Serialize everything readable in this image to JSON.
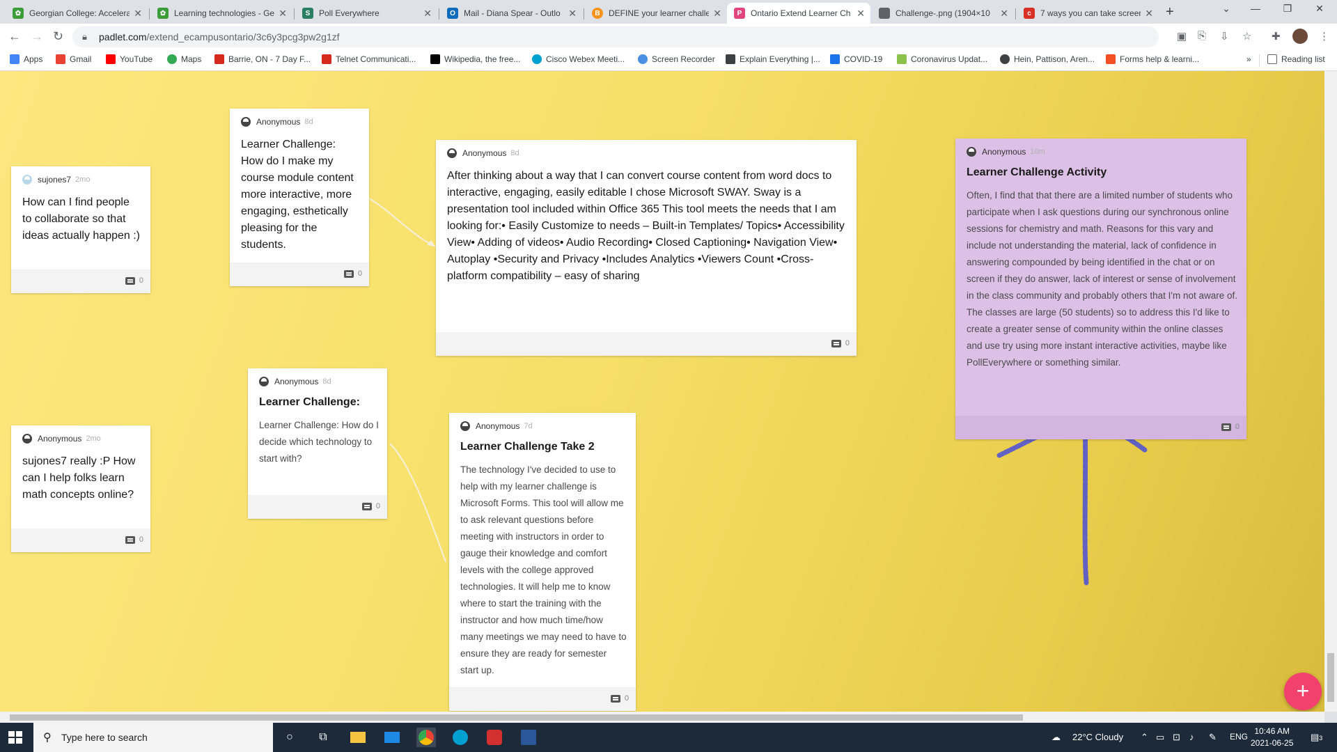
{
  "browser": {
    "tabs": [
      {
        "title": "Georgian College: Accelera",
        "icon_color": "#3a9d3a",
        "active": false
      },
      {
        "title": "Learning technologies - Ge",
        "icon_color": "#3a9d3a",
        "active": false
      },
      {
        "title": "Poll Everywhere",
        "icon_color": "#2a7f62",
        "active": false
      },
      {
        "title": "Mail - Diana Spear - Outlo",
        "icon_color": "#0f6cbd",
        "active": false
      },
      {
        "title": "DEFINE your learner challe",
        "icon_color": "#f7931a",
        "active": false
      },
      {
        "title": "Ontario Extend Learner Ch",
        "icon_color": "#e0457b",
        "active": true
      },
      {
        "title": "Challenge-.png (1904×10",
        "icon_color": "#5f6368",
        "active": false
      },
      {
        "title": "7 ways you can take screen",
        "icon_color": "#d93025",
        "active": false
      }
    ],
    "new_tab_label": "+",
    "url_domain": "padlet.com",
    "url_path": "/extend_ecampusontario/3c6y3pcg3pw2g1zf",
    "bookmarks": [
      {
        "label": "Apps",
        "icon_color": "#4285f4"
      },
      {
        "label": "Gmail",
        "icon_color": "#ea4335"
      },
      {
        "label": "YouTube",
        "icon_color": "#ff0000"
      },
      {
        "label": "Maps",
        "icon_color": "#34a853"
      },
      {
        "label": "Barrie, ON - 7 Day F...",
        "icon_color": "#d52b1e"
      },
      {
        "label": "Telnet Communicati...",
        "icon_color": "#d52b1e"
      },
      {
        "label": "Wikipedia, the free...",
        "icon_color": "#000000"
      },
      {
        "label": "Cisco Webex Meeti...",
        "icon_color": "#00a0d1"
      },
      {
        "label": "Screen Recorder",
        "icon_color": "#4a90e2"
      },
      {
        "label": "Explain Everything |...",
        "icon_color": "#3c4043"
      },
      {
        "label": "COVID-19",
        "icon_color": "#1a73e8"
      },
      {
        "label": "Coronavirus Updat...",
        "icon_color": "#8bc34a"
      },
      {
        "label": "Hein, Pattison, Aren...",
        "icon_color": "#3c4043"
      },
      {
        "label": "Forms help & learni...",
        "icon_color": "#f25022"
      }
    ],
    "bookmarks_overflow": "»",
    "reading_list": "Reading list"
  },
  "padlet": {
    "cards": [
      {
        "author": "sujones7",
        "time": "2mo",
        "big_text": "How can I find people to collaborate so that ideas actually happen :)",
        "comments": "0"
      },
      {
        "author": "Anonymous",
        "time": "8d",
        "big_text": "Learner Challenge: How do I make my course module content more interactive, more engaging, esthetically pleasing for the students.",
        "comments": "0"
      },
      {
        "author": "Anonymous",
        "time": "8d",
        "big_text": "After thinking about a way that I can convert course content from word docs to interactive, engaging, easily editable I chose Microsoft SWAY. Sway is a presentation tool included within Office 365 This tool meets the needs that I am looking for:•  Easily Customize to needs – Built-in Templates/ Topics• Accessibility View• Adding of videos• Audio Recording• Closed Captioning• Navigation View•  Autoplay •Security and Privacy •Includes Analytics •Viewers Count •Cross-platform compatibility – easy of sharing",
        "comments": "0"
      },
      {
        "author": "Anonymous",
        "time": "10m",
        "subject": "Learner Challenge Activity",
        "body": "Often, I find that that there are a limited number of students who participate when I ask questions during our synchronous online sessions for chemistry and math. Reasons for this vary and include not understanding the material, lack of confidence in answering compounded by being identified in the chat or on screen if they do answer, lack of interest or sense of involvement in the class community and probably others that I'm not aware of. The classes are large (50 students) so to address this I'd like to create a greater sense of community within the online classes and use try using more instant interactive activities, maybe like PollEverywhere or something similar.",
        "comments": "0"
      },
      {
        "author": "Anonymous",
        "time": "2mo",
        "big_text": "sujones7 really :P How can I help folks learn math concepts online?",
        "comments": "0"
      },
      {
        "author": "Anonymous",
        "time": "8d",
        "subject": "Learner Challenge:",
        "body": "Learner Challenge: How do I decide which technology to start with?",
        "comments": "0"
      },
      {
        "author": "Anonymous",
        "time": "7d",
        "subject": "Learner Challenge Take 2",
        "body": "The technology I've decided to use to help with my learner challenge is Microsoft Forms. This tool will allow me to ask relevant questions before meeting with instructors in order to gauge their knowledge and comfort levels with the college approved technologies. It will help me to know where to start the training with the instructor and how much time/how many meetings we may need to have to ensure they are ready for semester start up.",
        "comments": "0"
      }
    ],
    "fab_label": "+"
  },
  "taskbar": {
    "search_placeholder": "Type here to search",
    "weather": "22°C  Cloudy",
    "language": "ENG",
    "time": "10:46 AM",
    "date": "2021-06-25",
    "notifications": "3"
  }
}
